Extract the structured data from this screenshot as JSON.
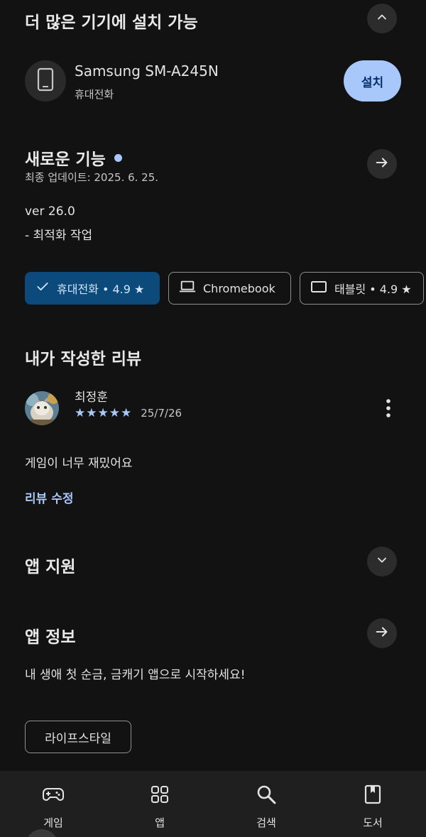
{
  "install_more": {
    "title": "더 많은 기기에 설치 가능",
    "device_name": "Samsung SM-A245N",
    "device_type": "휴대전화",
    "install_label": "설치"
  },
  "whats_new": {
    "title": "새로운 기능",
    "updated": "최종 업데이트: 2025. 6. 25.",
    "version": "ver 26.0",
    "note": "- 최적화 작업"
  },
  "device_chips": [
    {
      "label": "휴대전화 • 4.9 ★",
      "icon": "check-icon",
      "selected": true
    },
    {
      "label": "Chromebook",
      "icon": "laptop-icon",
      "selected": false
    },
    {
      "label": "태블릿 • 4.9 ★",
      "icon": "tablet-icon",
      "selected": false
    }
  ],
  "my_review": {
    "title": "내가 작성한 리뷰",
    "author": "최정훈",
    "stars": "★★★★★",
    "date": "25/7/26",
    "text": "게임이 너무 재밌어요",
    "edit_label": "리뷰 수정"
  },
  "app_support": {
    "title": "앱 지원"
  },
  "app_info": {
    "title": "앱 정보",
    "description": "내 생애 첫 순금, 금캐기 앱으로 시작하세요!",
    "category": "라이프스타일"
  },
  "bottom_nav": [
    {
      "label": "게임",
      "icon": "gamepad-icon"
    },
    {
      "label": "앱",
      "icon": "apps-grid-icon"
    },
    {
      "label": "검색",
      "icon": "search-icon"
    },
    {
      "label": "도서",
      "icon": "book-icon"
    }
  ],
  "colors": {
    "background": "#121212",
    "accent": "#a8c7fa",
    "selected_chip": "#0b4a7a",
    "link": "#a8c7fa"
  }
}
